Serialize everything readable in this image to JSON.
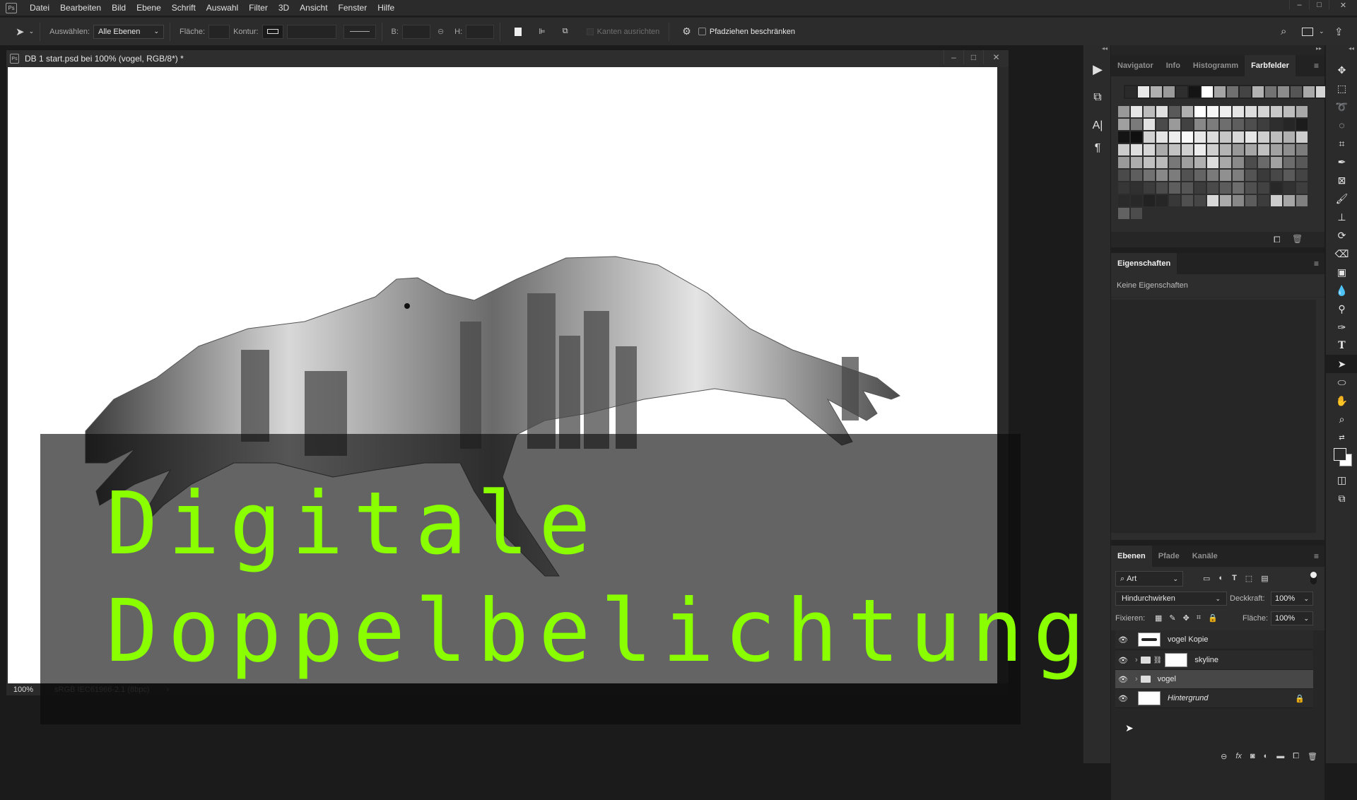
{
  "app": {
    "logo": "Ps"
  },
  "menu": [
    "Datei",
    "Bearbeiten",
    "Bild",
    "Ebene",
    "Schrift",
    "Auswahl",
    "Filter",
    "3D",
    "Ansicht",
    "Fenster",
    "Hilfe"
  ],
  "window_controls": {
    "minimize": "–",
    "maximize": "□",
    "close": "✕"
  },
  "options_bar": {
    "select_label": "Auswählen:",
    "select_value": "Alle Ebenen",
    "fill_label": "Fläche:",
    "stroke_label": "Kontur:",
    "width_label": "B:",
    "height_label": "H:",
    "align_edges_label": "Kanten ausrichten",
    "constrain_path_label": "Pfadziehen beschränken"
  },
  "document": {
    "title": "DB 1 start.psd bei 100% (vogel, RGB/8*) *",
    "zoom": "100%",
    "color_profile": "sRGB IEC61966-2.1 (8bpc)",
    "status_arrow": "›",
    "headline_line1": "Digitale",
    "headline_line2": "Doppelbelichtung",
    "headline_color": "#8aff00"
  },
  "panels": {
    "top_tabs": [
      "Navigator",
      "Info",
      "Histogramm",
      "Farbfelder"
    ],
    "top_active": "Farbfelder",
    "properties_tab": "Eigenschaften",
    "properties_text": "Keine Eigenschaften",
    "layers_tabs": [
      "Ebenen",
      "Pfade",
      "Kanäle"
    ],
    "layers_active": "Ebenen",
    "filter_kind": "Art",
    "blend_mode": "Hindurchwirken",
    "opacity_label": "Deckkraft:",
    "opacity_value": "100%",
    "lock_label": "Fixieren:",
    "fill_label": "Fläche:",
    "fill_value": "100%",
    "layers": [
      {
        "name": "vogel Kopie",
        "type": "pixel",
        "visible": true,
        "selected": false,
        "locked": false,
        "italic": false
      },
      {
        "name": "skyline",
        "type": "group-masked",
        "visible": true,
        "selected": false,
        "locked": false,
        "italic": false
      },
      {
        "name": "vogel",
        "type": "group",
        "visible": true,
        "selected": true,
        "locked": false,
        "italic": false
      },
      {
        "name": "Hintergrund",
        "type": "background",
        "visible": true,
        "selected": false,
        "locked": true,
        "italic": true
      }
    ]
  },
  "swatches": {
    "recent": [
      "#2a2a2a",
      "#e8e8e8",
      "#b0b0b0",
      "#9a9a9a",
      "#2e2e2e",
      "#141414",
      "#ffffff",
      "#a4a4a4",
      "#707070",
      "#444444",
      "#b2b2b2",
      "#737373",
      "#8c8c8c",
      "#555555",
      "#a8a8a8",
      "#d4d4d4"
    ],
    "rows": [
      [
        "#999999",
        "#e6e6e6",
        "#bcbcbc",
        "#e0e0e0",
        "#595959",
        "#b0b0b0",
        "#ffffff",
        "#f6f6f6",
        "#eeeeee",
        "#e4e4e4",
        "#dddddd",
        "#d4d4d4",
        "#c8c8c8",
        "#bdbdbd",
        "#a8a8a8"
      ],
      [
        "#a0a0a0",
        "#7a7a7a",
        "#e2e2e2",
        "#4a4a4a",
        "#9a9a9a",
        "#424242",
        "#888888",
        "#7c7c7c",
        "#6e6e6e",
        "#5e5e5e",
        "#4e4e4e",
        "#3e3e3e",
        "#2e2e2e",
        "#262626",
        "#1c1c1c"
      ],
      [
        "#141414",
        "#101010",
        "#d2d2d2",
        "#e4e4e4",
        "#ececec",
        "#fafafa",
        "#e8e8e8",
        "#dcdcdc",
        "#c6c6c6",
        "#d8d8d8",
        "#e6e6e6",
        "#cecece",
        "#bdbdbd",
        "#b0b0b0",
        "#cdcdcd"
      ],
      [
        "#cccccc",
        "#dedede",
        "#d6d6d6",
        "#aaaaaa",
        "#c2c2c2",
        "#d0d0d0",
        "#ececec",
        "#cfcfcf",
        "#b4b4b4",
        "#989898",
        "#a6a6a6",
        "#c0c0c0",
        "#a2a2a2",
        "#8e8e8e",
        "#7c7c7c"
      ],
      [
        "#9a9a9a",
        "#acacac",
        "#c0c0c0",
        "#bababa",
        "#787878",
        "#9e9e9e",
        "#b0b0b0",
        "#dcdcdc",
        "#a8a8a8",
        "#8a8a8a",
        "#4c4c4c",
        "#6a6a6a",
        "#a2a2a2",
        "#6c6c6c",
        "#585858"
      ],
      [
        "#4a4a4a",
        "#5e5e5e",
        "#727272",
        "#888888",
        "#7c7c7c",
        "#525252",
        "#646464",
        "#7a7a7a",
        "#909090",
        "#7e7e7e",
        "#545454",
        "#3a3a3a",
        "#484848",
        "#5a5a5a",
        "#444444"
      ],
      [
        "#363636",
        "#303030",
        "#3c3c3c",
        "#4c4c4c",
        "#5e5e5e",
        "#565656",
        "#3c3c3c",
        "#4a4a4a",
        "#5c5c5c",
        "#6e6e6e",
        "#505050",
        "#424242",
        "#282828",
        "#323232",
        "#3e3e3e"
      ],
      [
        "#2a2a2a",
        "#282828",
        "#222222",
        "#262626",
        "#383838",
        "#505050",
        "#464646",
        "#d8d8d8",
        "#aaaaaa",
        "#888888",
        "#5c5c5c",
        "#3c3c3c",
        "#cccccc",
        "#a6a6a6",
        "#808080"
      ],
      [
        "#626262",
        "#4c4c4c"
      ]
    ]
  },
  "tools": [
    "move",
    "marquee",
    "lasso",
    "quick-select",
    "crop",
    "eyedropper",
    "frame",
    "brush",
    "stamp",
    "history-brush",
    "eraser",
    "gradient",
    "blur",
    "dodge",
    "pen",
    "type",
    "path-select",
    "ellipse",
    "hand",
    "zoom"
  ],
  "active_tool": "path-select"
}
